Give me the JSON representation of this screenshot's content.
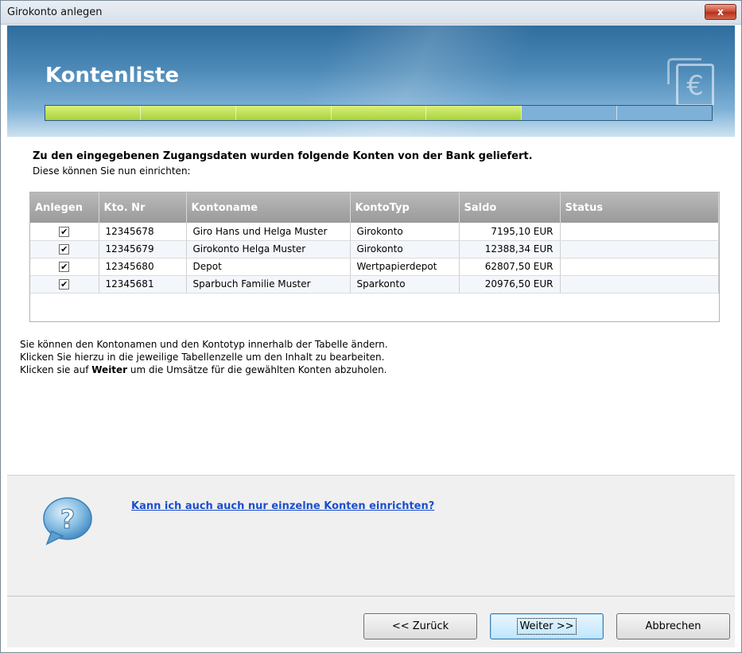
{
  "window": {
    "title": "Girokonto anlegen",
    "close_label": "x"
  },
  "banner": {
    "heading": "Kontenliste",
    "icon": "euro-wallet-icon",
    "icon_glyph": "€"
  },
  "progress": {
    "total_steps": 7,
    "completed_steps": 5
  },
  "intro": {
    "bold": "Zu den eingegebenen Zugangsdaten wurden folgende Konten von der Bank geliefert.",
    "sub": "Diese können Sie nun einrichten:"
  },
  "table": {
    "headers": [
      "Anlegen",
      "Kto. Nr",
      "Kontoname",
      "KontoTyp",
      "Saldo",
      "Status"
    ],
    "rows": [
      {
        "anlegen": true,
        "kto_nr": "12345678",
        "kontoname": "Giro Hans und Helga Muster",
        "kontotyp": "Girokonto",
        "saldo": "7195,10 EUR",
        "status": ""
      },
      {
        "anlegen": true,
        "kto_nr": "12345679",
        "kontoname": "Girokonto Helga Muster",
        "kontotyp": "Girokonto",
        "saldo": "12388,34 EUR",
        "status": ""
      },
      {
        "anlegen": true,
        "kto_nr": "12345680",
        "kontoname": "Depot",
        "kontotyp": "Wertpapierdepot",
        "saldo": "62807,50 EUR",
        "status": ""
      },
      {
        "anlegen": true,
        "kto_nr": "12345681",
        "kontoname": "Sparbuch Familie Muster",
        "kontotyp": "Sparkonto",
        "saldo": "20976,50 EUR",
        "status": ""
      }
    ]
  },
  "hint": {
    "line1": "Sie können den Kontonamen und den Kontotyp innerhalb der Tabelle ändern.",
    "line2": "Klicken Sie hierzu in die jeweilige Tabellenzelle um den Inhalt zu bearbeiten.",
    "line3_prefix": "Klicken sie auf ",
    "line3_bold": "Weiter",
    "line3_suffix": " um die Umsätze für die gewählten Konten abzuholen."
  },
  "help": {
    "link": "Kann ich auch auch nur einzelne Konten einrichten?",
    "icon": "question-bubble-icon",
    "icon_glyph": "?"
  },
  "footer": {
    "back_label": "<< Zurück",
    "next_label": "Weiter >>",
    "cancel_label": "Abbrechen"
  },
  "colors": {
    "banner": "#4d8ab8",
    "progress_done": "#a9d23a",
    "progress_todo": "#7eb0d8",
    "link": "#1a4fcf"
  }
}
